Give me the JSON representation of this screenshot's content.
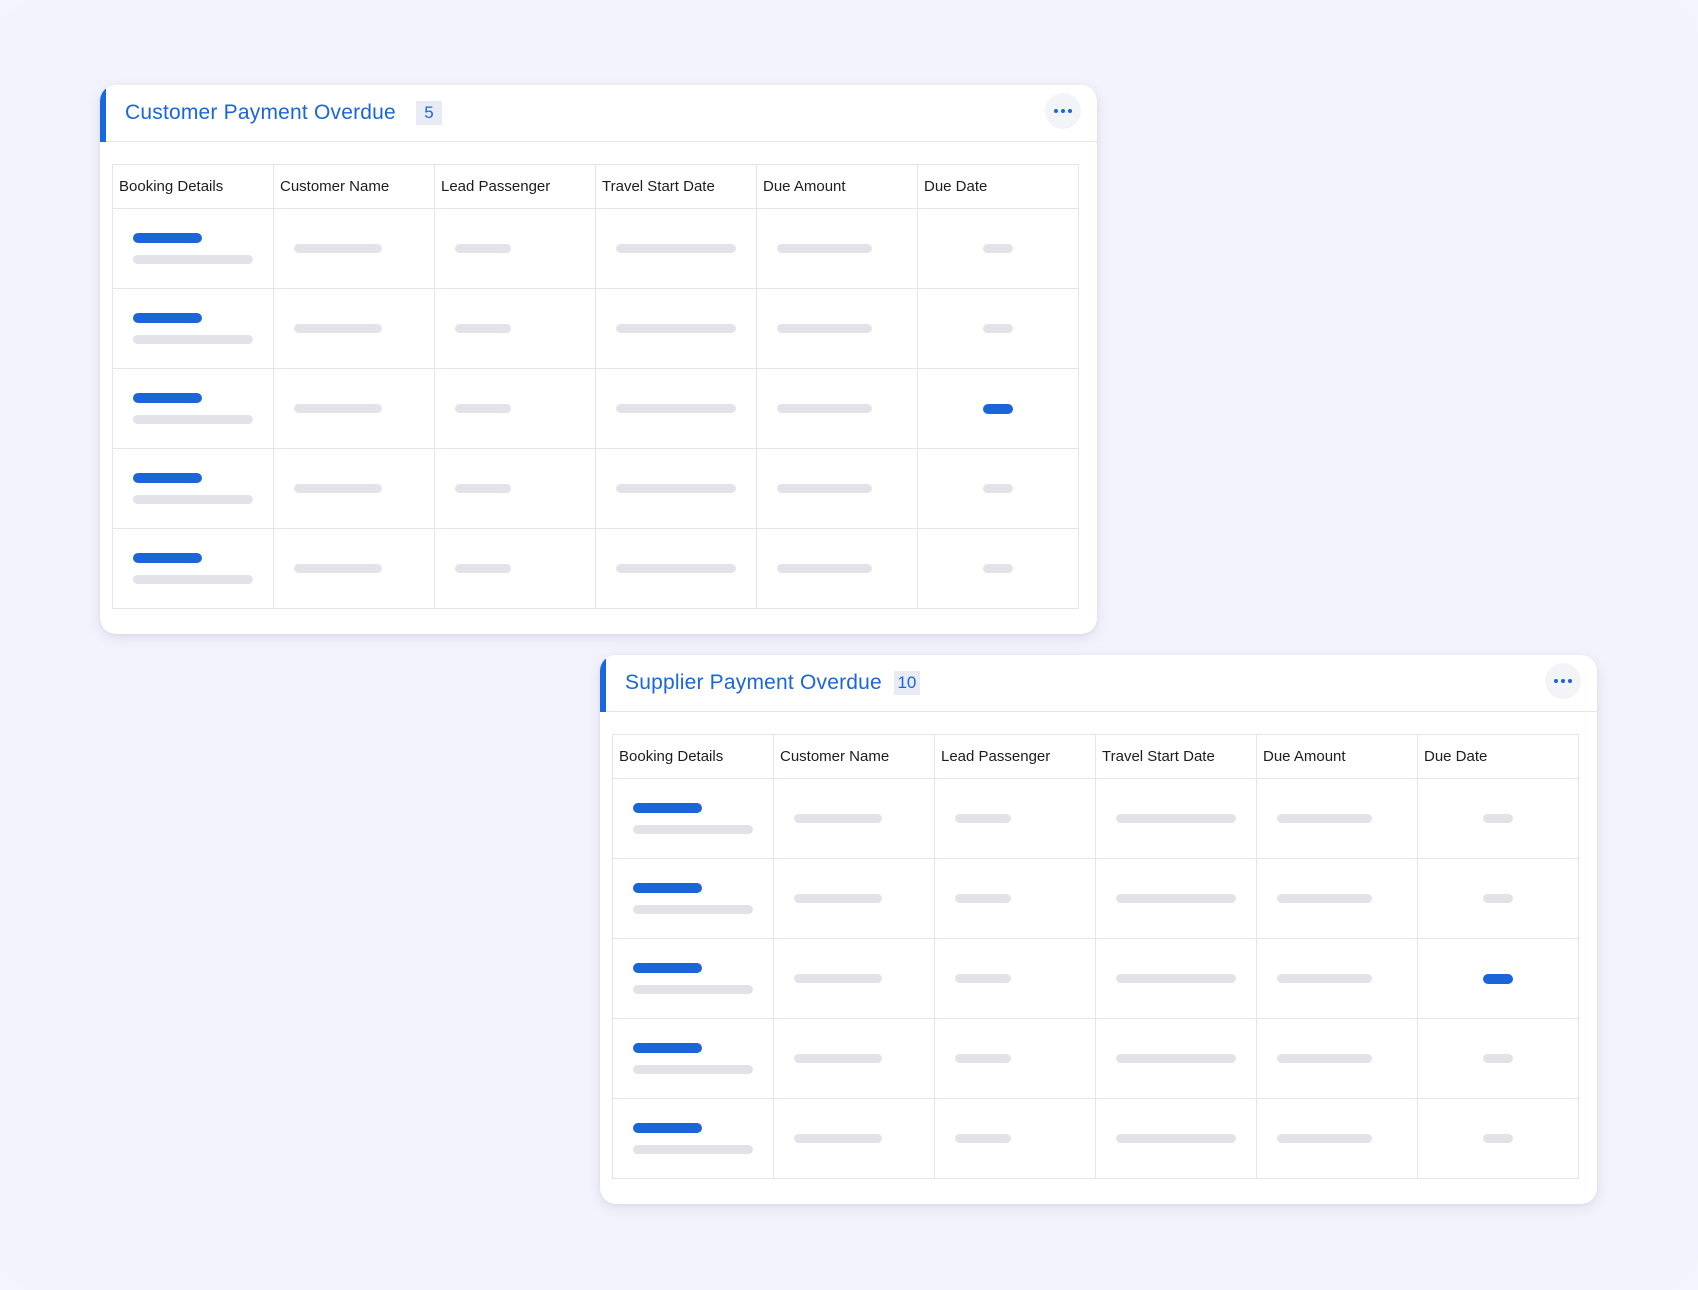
{
  "cards": [
    {
      "title": "Customer Payment Overdue",
      "count": "5",
      "columns": [
        "Booking Details",
        "Customer Name",
        "Lead Passenger",
        "Travel Start Date",
        "Due Amount",
        "Due Date"
      ],
      "highlighted_due_row": 3
    },
    {
      "title": "Supplier Payment Overdue",
      "count": "10",
      "columns": [
        "Booking Details",
        "Customer Name",
        "Lead Passenger",
        "Travel Start Date",
        "Due Amount",
        "Due Date"
      ],
      "highlighted_due_row": 3
    }
  ],
  "icons": {
    "more": "more-horizontal-icon"
  },
  "colors": {
    "accent": "#1a66d9",
    "skeleton": "#e2e3e8",
    "background": "#f2f3fc"
  }
}
